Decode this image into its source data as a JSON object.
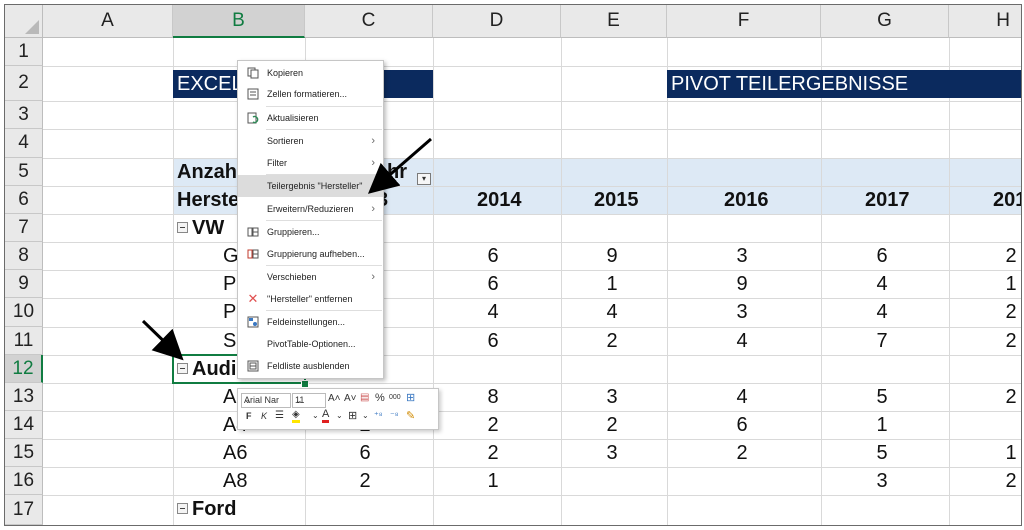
{
  "columns": [
    "A",
    "B",
    "C",
    "D",
    "E",
    "F",
    "G",
    "H"
  ],
  "rows": [
    "1",
    "2",
    "3",
    "4",
    "5",
    "6",
    "7",
    "8",
    "9",
    "10",
    "11",
    "12",
    "13",
    "14",
    "15",
    "16",
    "17"
  ],
  "titles": {
    "left": "EXCEL",
    "right": "PIVOT TEILERGEBNISSE"
  },
  "pivot": {
    "row5_label": "Anzahl",
    "row5_suffix": "hr",
    "row6_label": "Herste",
    "row6_c_fragment": "3",
    "years": [
      "2014",
      "2015",
      "2016",
      "2017",
      "201"
    ],
    "groups": {
      "vw": "VW",
      "audi": "Audi",
      "ford": "Ford"
    },
    "items": [
      {
        "label": "G",
        "c": "",
        "d": "6",
        "e": "9",
        "f": "3",
        "g": "6",
        "h": "2"
      },
      {
        "label": "Pa",
        "c": "",
        "d": "6",
        "e": "1",
        "f": "9",
        "g": "4",
        "h": "1"
      },
      {
        "label": "Po",
        "c": "",
        "d": "4",
        "e": "4",
        "f": "3",
        "g": "4",
        "h": "2"
      },
      {
        "label": "Sh",
        "c": "",
        "d": "6",
        "e": "2",
        "f": "4",
        "g": "7",
        "h": "2"
      },
      {
        "label": "",
        "c": "",
        "d": "",
        "e": "",
        "f": "",
        "g": "",
        "h": ""
      },
      {
        "label": "A3",
        "c": "",
        "d": "8",
        "e": "3",
        "f": "4",
        "g": "5",
        "h": "2"
      },
      {
        "label": "A4",
        "c": "2",
        "d": "2",
        "e": "2",
        "f": "6",
        "g": "1",
        "h": ""
      },
      {
        "label": "A6",
        "c": "6",
        "d": "2",
        "e": "3",
        "f": "2",
        "g": "5",
        "h": "1"
      },
      {
        "label": "A8",
        "c": "2",
        "d": "1",
        "e": "",
        "f": "",
        "g": "3",
        "h": "2"
      }
    ]
  },
  "context_menu": {
    "items": [
      {
        "label": "Kopieren",
        "icon": "copy-icon",
        "submenu": false
      },
      {
        "label": "Zellen formatieren...",
        "icon": "format-cells-icon",
        "submenu": false
      },
      {
        "label": "Aktualisieren",
        "icon": "refresh-icon",
        "submenu": false
      },
      {
        "label": "Sortieren",
        "icon": "",
        "submenu": true
      },
      {
        "label": "Filter",
        "icon": "",
        "submenu": true
      },
      {
        "label": "Teilergebnis \"Hersteller\"",
        "icon": "",
        "submenu": false,
        "highlighted": true
      },
      {
        "label": "Erweitern/Reduzieren",
        "icon": "",
        "submenu": true
      },
      {
        "label": "Gruppieren...",
        "icon": "group-icon",
        "submenu": false
      },
      {
        "label": "Gruppierung aufheben...",
        "icon": "ungroup-icon",
        "submenu": false
      },
      {
        "label": "Verschieben",
        "icon": "",
        "submenu": true
      },
      {
        "label": "\"Hersteller\" entfernen",
        "icon": "remove-x-icon",
        "submenu": false
      },
      {
        "label": "Feldeinstellungen...",
        "icon": "field-settings-icon",
        "submenu": false
      },
      {
        "label": "PivotTable-Optionen...",
        "icon": "",
        "submenu": false
      },
      {
        "label": "Feldliste ausblenden",
        "icon": "field-list-icon",
        "submenu": false
      }
    ]
  },
  "mini_toolbar": {
    "font_name": "Arial Nar",
    "font_size": "11",
    "bold_glyph": "F",
    "italic_glyph": "K",
    "percent_glyph": "%",
    "thousands_glyph": "000"
  },
  "colors": {
    "navy": "#0b2a5e",
    "selection": "#107c41",
    "pivot_header": "#dde9f5"
  }
}
